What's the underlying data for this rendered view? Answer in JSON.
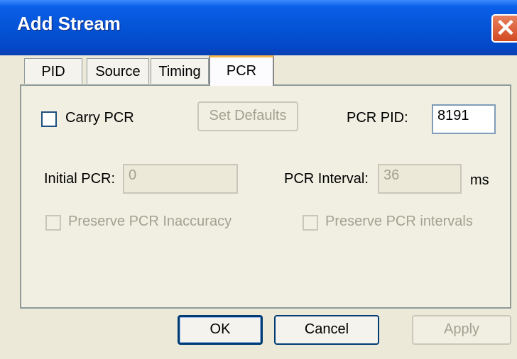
{
  "window": {
    "title": "Add Stream",
    "close_icon_glyph": "✕"
  },
  "tabs": [
    {
      "label": "PID"
    },
    {
      "label": "Source"
    },
    {
      "label": "Timing"
    },
    {
      "label": "PCR",
      "active": true
    }
  ],
  "pcr": {
    "carry_pcr_label": "Carry PCR",
    "carry_pcr_checked": false,
    "set_defaults_label": "Set Defaults",
    "pcr_pid_label": "PCR PID:",
    "pcr_pid_value": "8191",
    "initial_pcr_label": "Initial PCR:",
    "initial_pcr_value": "0",
    "pcr_interval_label": "PCR Interval:",
    "pcr_interval_value": "36",
    "pcr_interval_unit": "ms",
    "preserve_inaccuracy_label": "Preserve PCR Inaccuracy",
    "preserve_intervals_label": "Preserve PCR intervals"
  },
  "buttons": {
    "ok": "OK",
    "cancel": "Cancel",
    "apply": "Apply"
  }
}
